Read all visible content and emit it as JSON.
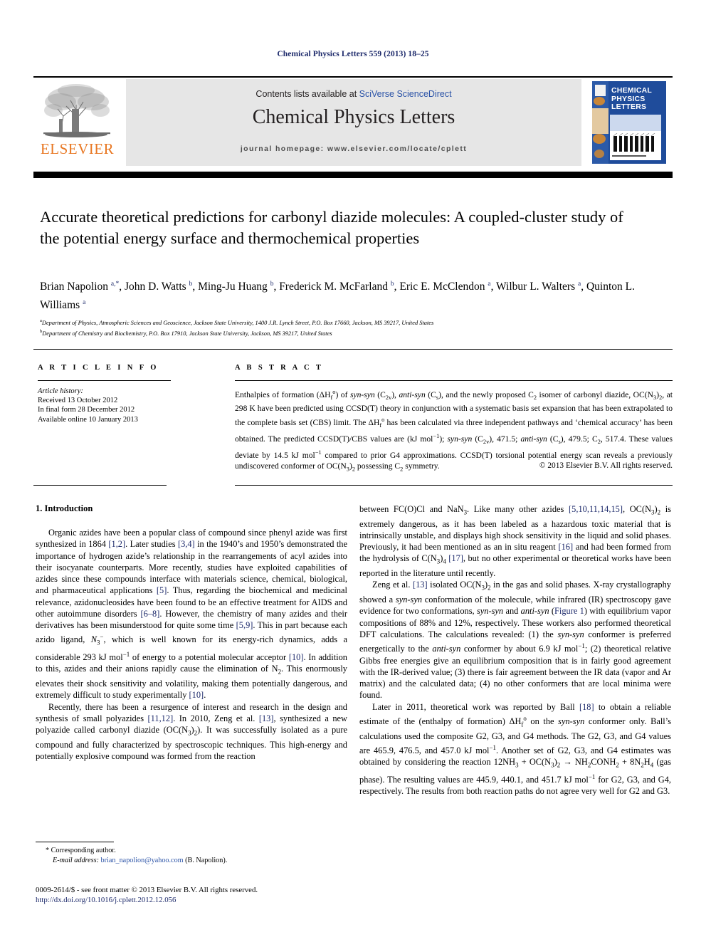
{
  "running_head": "Chemical Physics Letters 559 (2013) 18–25",
  "header": {
    "publisher": "ELSEVIER",
    "contents_prefix": "Contents lists available at ",
    "contents_link": "SciVerse ScienceDirect",
    "journal_title": "Chemical Physics Letters",
    "homepage": "journal homepage: www.elsevier.com/locate/cplett",
    "cover_title_line1": "CHEMICAL",
    "cover_title_line2": "PHYSICS",
    "cover_title_line3": "LETTERS"
  },
  "article": {
    "title": "Accurate theoretical predictions for carbonyl diazide molecules: A coupled-cluster study of the potential energy surface and thermochemical properties",
    "authors_html": "Brian Napolion <sup>a,*</sup>, John D. Watts <sup>b</sup>, Ming-Ju Huang <sup>b</sup>, Frederick M. McFarland <sup>b</sup>, Eric E. McClendon <sup>a</sup>, Wilbur L. Walters <sup>a</sup>, Quinton L. Williams <sup>a</sup>",
    "affiliation_a": "Department of Physics, Atmospheric Sciences and Geoscience, Jackson State University, 1400 J.R. Lynch Street, P.O. Box 17660, Jackson, MS 39217, United States",
    "affiliation_b": "Department of Chemistry and Biochemistry, P.O. Box 17910, Jackson State University, Jackson, MS 39217, United States"
  },
  "article_info": {
    "heading": "A R T I C L E   I N F O",
    "history_label": "Article history:",
    "received": "Received 13 October 2012",
    "final_form": "In final form 28 December 2012",
    "available": "Available online 10 January 2013"
  },
  "abstract": {
    "heading": "A B S T R A C T",
    "text_html": "Enthalpies of formation (&Delta;H<sub>f</sub><sup class=\"sm\">o</sup>) of <i>syn-syn</i> (C<sub>2v</sub>), <i>anti-syn</i> (C<sub>s</sub>), and the newly proposed C<sub>2</sub> isomer of carbonyl diazide, OC(N<sub>3</sub>)<sub>2</sub>, at 298 K have been predicted using CCSD(T) theory in conjunction with a systematic basis set expansion that has been extrapolated to the complete basis set (CBS) limit. The &Delta;H<sub>f</sub><sup class=\"sm\">o</sup> has been calculated via three independent pathways and &lsquo;chemical accuracy&rsquo; has been obtained. The predicted CCSD(T)/CBS values are (kJ mol<sup class=\"sm\">&minus;1</sup>); <i>syn-syn</i> (C<sub>2v</sub>), 471.5; <i>anti-syn</i> (C<sub>s</sub>), 479.5; C<sub>2</sub>, 517.4. These values deviate by 14.5 kJ mol<sup class=\"sm\">&minus;1</sup> compared to prior G4 approximations. CCSD(T) torsional potential energy scan reveals a previously undiscovered conformer of OC(N<sub>3</sub>)<sub>2</sub> possessing C<sub>2</sub> symmetry.",
    "copyright": "© 2013 Elsevier B.V. All rights reserved."
  },
  "body": {
    "section_heading": "1. Introduction",
    "left_p1_html": "Organic azides have been a popular class of compound since phenyl azide was first synthesized in 1864 <span class=\"ref\">[1,2]</span>. Later studies <span class=\"ref\">[3,4]</span> in the 1940&rsquo;s and 1950&rsquo;s demonstrated the importance of hydrogen azide&rsquo;s relationship in the rearrangements of acyl azides into their isocyanate counterparts. More recently, studies have exploited capabilities of azides since these compounds interface with materials science, chemical, biological, and pharmaceutical applications <span class=\"ref\">[5]</span>. Thus, regarding the biochemical and medicinal relevance, azidonucleosides have been found to be an effective treatment for AIDS and other autoimmune disorders <span class=\"ref\">[6&ndash;8]</span>. However, the chemistry of many azides and their derivatives has been misunderstood for quite some time <span class=\"ref\">[5,9]</span>. This in part because each azido ligand, <i>N</i><sub>3</sub><sup class=\"sm\">&minus;</sup>, which is well known for its energy-rich dynamics, adds a considerable 293 kJ mol<sup class=\"sm\">&minus;1</sup> of energy to a potential molecular acceptor <span class=\"ref\">[10]</span>. In addition to this, azides and their anions rapidly cause the elimination of N<sub>2</sub>. This enormously elevates their shock sensitivity and volatility, making them potentially dangerous, and extremely difficult to study experimentally <span class=\"ref\">[10]</span>.",
    "left_p2_html": "Recently, there has been a resurgence of interest and research in the design and synthesis of small polyazides <span class=\"ref\">[11,12]</span>. In 2010, Zeng et al. <span class=\"ref\">[13]</span>, synthesized a new polyazide called carbonyl diazide (OC(N<sub>3</sub>)<sub>2</sub>). It was successfully isolated as a pure compound and fully characterized by spectroscopic techniques. This high-energy and potentially explosive compound was formed from the reaction",
    "right_p1_html": "between FC(O)Cl and NaN<sub>3</sub>. Like many other azides <span class=\"ref\">[5,10,11,14,15]</span>, OC(N<sub>3</sub>)<sub>2</sub> is extremely dangerous, as it has been labeled as a hazardous toxic material that is intrinsically unstable, and displays high shock sensitivity in the liquid and solid phases. Previously, it had been mentioned as an in situ reagent <span class=\"ref\">[16]</span> and had been formed from the hydrolysis of C(N<sub>3</sub>)<sub>4</sub> <span class=\"ref\">[17]</span>, but no other experimental or theoretical works have been reported in the literature until recently.",
    "right_p2_html": "Zeng et al. <span class=\"ref\">[13]</span> isolated OC(N<sub>3</sub>)<sub>2</sub> in the gas and solid phases. X-ray crystallography showed a <i>syn-syn</i> conformation of the molecule, while infrared (IR) spectroscopy gave evidence for two conformations, <i>syn-syn</i> and <i>anti-syn</i> (<span class=\"ref\">Figure 1</span>) with equilibrium vapor compositions of 88% and 12%, respectively. These workers also performed theoretical DFT calculations. The calculations revealed: (1) the <i>syn-syn</i> conformer is preferred energetically to the <i>anti-syn</i> conformer by about 6.9 kJ mol<sup class=\"sm\">&minus;1</sup>; (2) theoretical relative Gibbs free energies give an equilibrium composition that is in fairly good agreement with the IR-derived value; (3) there is fair agreement between the IR data (vapor and Ar matrix) and the calculated data; (4) no other conformers that are local minima were found.",
    "right_p3_html": "Later in 2011, theoretical work was reported by Ball <span class=\"ref\">[18]</span> to obtain a reliable estimate of the (enthalpy of formation) &Delta;H<sub>f</sub><sup class=\"sm\">o</sup> on the <i>syn-syn</i> conformer only. Ball&rsquo;s calculations used the composite G2, G3, and G4 methods. The G2, G3, and G4 values are 465.9, 476.5, and 457.0 kJ mol<sup class=\"sm\">&minus;1</sup>. Another set of G2, G3, and G4 estimates was obtained by considering the reaction 12NH<sub>3</sub> + OC(N<sub>3</sub>)<sub>2</sub> &rarr; NH<sub>2</sub>CONH<sub>2</sub> + 8N<sub>2</sub>H<sub>4</sub> (gas phase). The resulting values are 445.9, 440.1, and 451.7 kJ mol<sup class=\"sm\">&minus;1</sup> for G2, G3, and G4, respectively. The results from both reaction paths do not agree very well for G2 and G3."
  },
  "footnote": {
    "corresponding": "* Corresponding author.",
    "email_label": "E-mail address:",
    "email": "brian_napolion@yahoo.com",
    "email_owner": "(B. Napolion)."
  },
  "imprint": {
    "issn_line": "0009-2614/$ - see front matter © 2013 Elsevier B.V. All rights reserved.",
    "doi": "http://dx.doi.org/10.1016/j.cplett.2012.12.056"
  },
  "colors": {
    "link_blue": "#2b53a7",
    "ref_blue": "#1d2a6b",
    "elsevier_orange": "#E87722",
    "band_grey": "#e6e6e6",
    "cover_blue": "#1f4c9b"
  }
}
